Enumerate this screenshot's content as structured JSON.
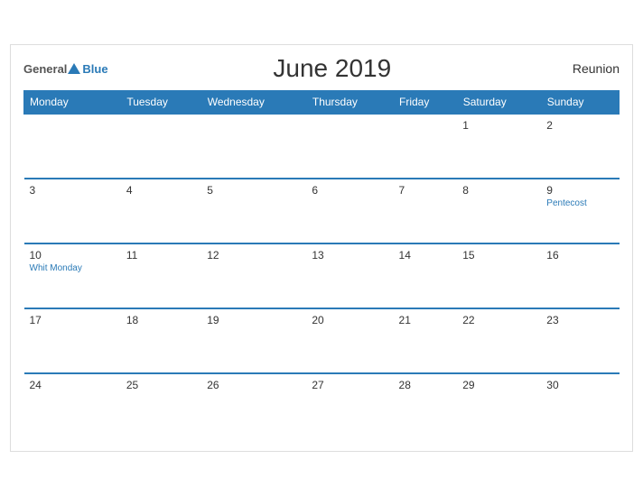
{
  "header": {
    "title": "June 2019",
    "region": "Reunion",
    "logo_general": "General",
    "logo_blue": "Blue"
  },
  "weekdays": [
    "Monday",
    "Tuesday",
    "Wednesday",
    "Thursday",
    "Friday",
    "Saturday",
    "Sunday"
  ],
  "weeks": [
    [
      {
        "day": "",
        "empty": true
      },
      {
        "day": "",
        "empty": true
      },
      {
        "day": "",
        "empty": true
      },
      {
        "day": "",
        "empty": true
      },
      {
        "day": "",
        "empty": true
      },
      {
        "day": "1",
        "empty": false,
        "event": ""
      },
      {
        "day": "2",
        "empty": false,
        "event": ""
      }
    ],
    [
      {
        "day": "3",
        "empty": false,
        "event": ""
      },
      {
        "day": "4",
        "empty": false,
        "event": ""
      },
      {
        "day": "5",
        "empty": false,
        "event": ""
      },
      {
        "day": "6",
        "empty": false,
        "event": ""
      },
      {
        "day": "7",
        "empty": false,
        "event": ""
      },
      {
        "day": "8",
        "empty": false,
        "event": ""
      },
      {
        "day": "9",
        "empty": false,
        "event": "Pentecost"
      }
    ],
    [
      {
        "day": "10",
        "empty": false,
        "event": "Whit Monday"
      },
      {
        "day": "11",
        "empty": false,
        "event": ""
      },
      {
        "day": "12",
        "empty": false,
        "event": ""
      },
      {
        "day": "13",
        "empty": false,
        "event": ""
      },
      {
        "day": "14",
        "empty": false,
        "event": ""
      },
      {
        "day": "15",
        "empty": false,
        "event": ""
      },
      {
        "day": "16",
        "empty": false,
        "event": ""
      }
    ],
    [
      {
        "day": "17",
        "empty": false,
        "event": ""
      },
      {
        "day": "18",
        "empty": false,
        "event": ""
      },
      {
        "day": "19",
        "empty": false,
        "event": ""
      },
      {
        "day": "20",
        "empty": false,
        "event": ""
      },
      {
        "day": "21",
        "empty": false,
        "event": ""
      },
      {
        "day": "22",
        "empty": false,
        "event": ""
      },
      {
        "day": "23",
        "empty": false,
        "event": ""
      }
    ],
    [
      {
        "day": "24",
        "empty": false,
        "event": ""
      },
      {
        "day": "25",
        "empty": false,
        "event": ""
      },
      {
        "day": "26",
        "empty": false,
        "event": ""
      },
      {
        "day": "27",
        "empty": false,
        "event": ""
      },
      {
        "day": "28",
        "empty": false,
        "event": ""
      },
      {
        "day": "29",
        "empty": false,
        "event": ""
      },
      {
        "day": "30",
        "empty": false,
        "event": ""
      }
    ]
  ]
}
